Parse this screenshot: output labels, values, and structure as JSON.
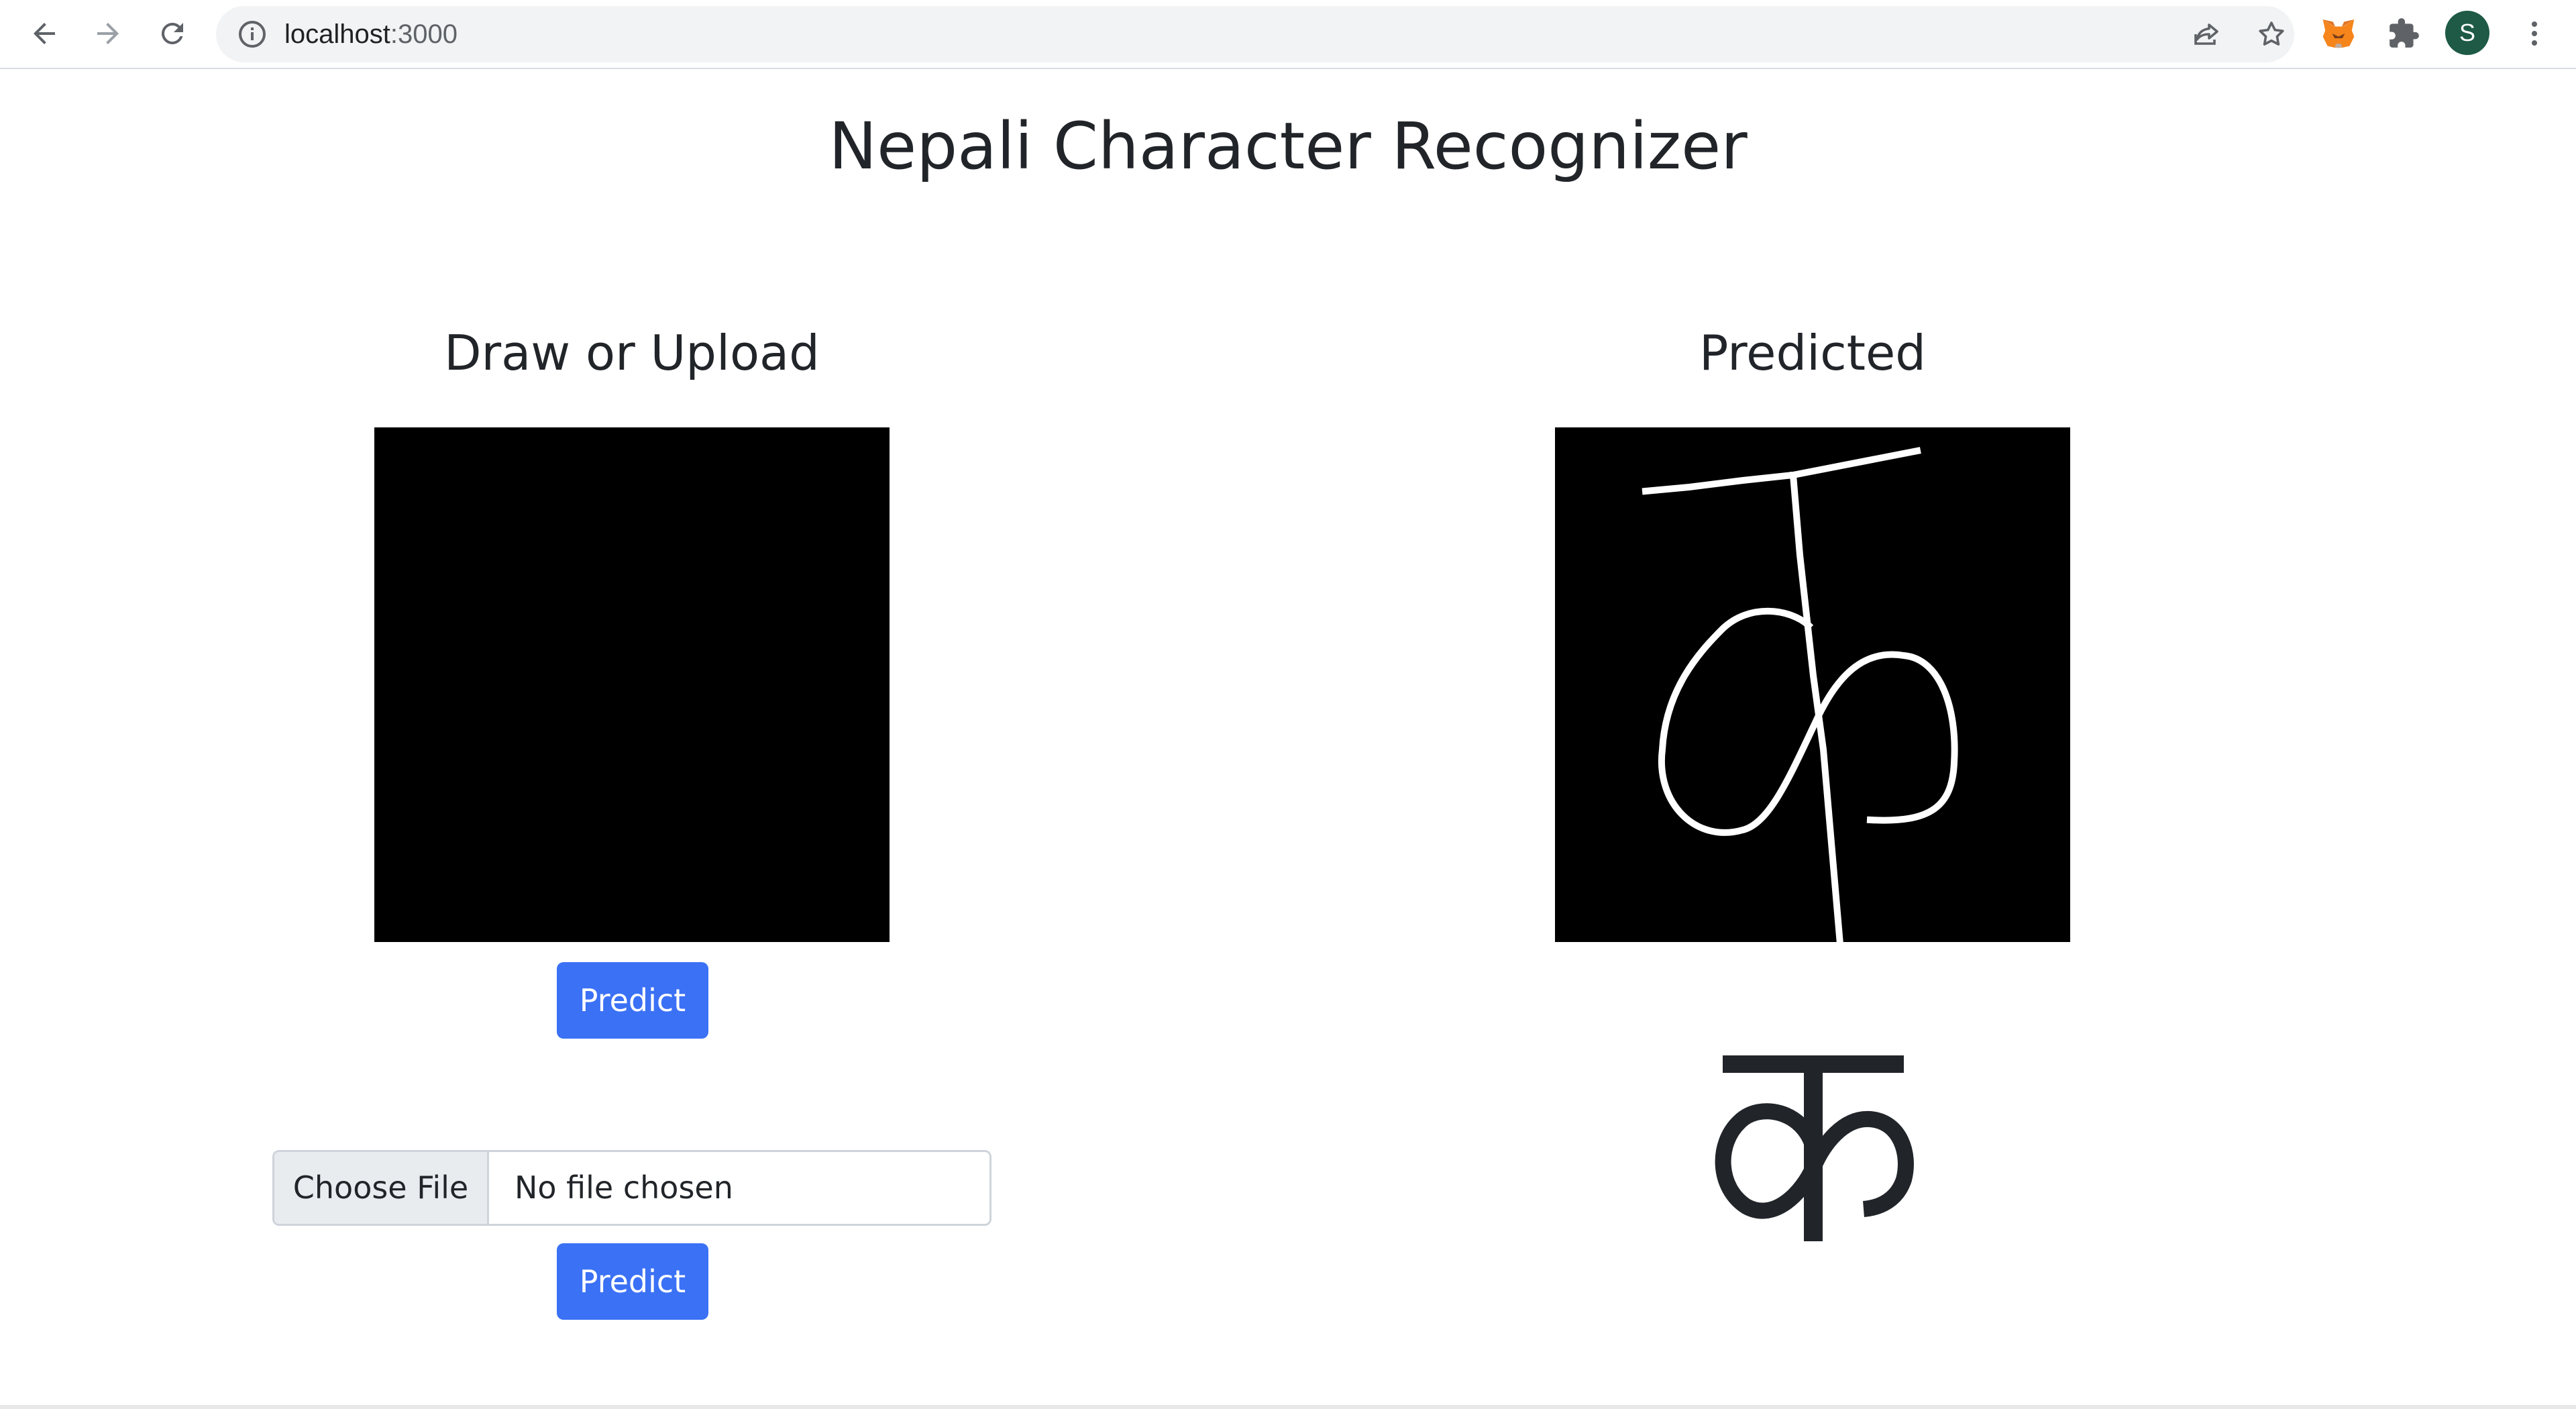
{
  "browser": {
    "url_host": "localhost",
    "url_port": ":3000",
    "profile_initial": "S",
    "icons": [
      "back-icon",
      "forward-icon",
      "reload-icon",
      "site-info-icon",
      "share-icon",
      "bookmark-star-icon",
      "metamask-fox-icon",
      "extensions-puzzle-icon",
      "avatar",
      "menu-dots-icon"
    ]
  },
  "page": {
    "title": "Nepali Character Recognizer"
  },
  "draw_panel": {
    "heading": "Draw or Upload",
    "predict_label": "Predict",
    "file_input": {
      "button_label": "Choose File",
      "status": "No file chosen"
    },
    "upload_predict_label": "Predict"
  },
  "result_panel": {
    "heading": "Predicted"
  },
  "colors": {
    "primary": "#3b71f5",
    "canvas_bg": "#000000",
    "text": "#212529",
    "avatar_bg": "#1e5a46"
  }
}
